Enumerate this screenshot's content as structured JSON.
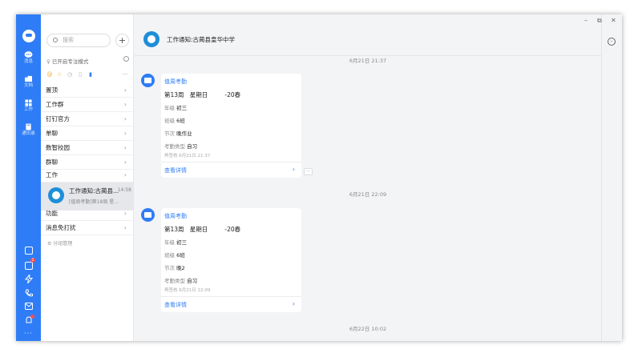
{
  "nav": {
    "items": [
      {
        "label": "消息",
        "icon": "message-icon"
      },
      {
        "label": "文档",
        "icon": "document-icon"
      },
      {
        "label": "工作",
        "icon": "work-grid-icon"
      },
      {
        "label": "通讯录",
        "icon": "contacts-icon"
      }
    ],
    "bottom_badge": "2"
  },
  "list": {
    "search_placeholder": "搜索",
    "focus_mode": "已开启专注模式",
    "groups_top": [
      "置顶",
      "工作群",
      "钉钉官方",
      "单聊",
      "数智校园",
      "群聊",
      "工作"
    ],
    "conversation": {
      "name": "工作通知:古蔺县...",
      "time": "14:58",
      "preview": "[值周考勤]第18周 星..."
    },
    "groups_bottom": [
      "功能",
      "消息免打扰"
    ],
    "manage": "分组管理"
  },
  "chat": {
    "title": "工作通知:古蔺县皇华中学",
    "messages": [
      {
        "time": "6月21日 21:37",
        "app": "值周考勤",
        "week": "第13周",
        "weekday": "星期日",
        "term": "-20春",
        "grade_label": "年级",
        "grade": "初三",
        "class_label": "班级",
        "class": "6班",
        "period_label": "节次",
        "period": "晚作业",
        "type_label": "考勤类型",
        "type": "自习",
        "publish": "再签核 6月21日 21:37",
        "view": "查看详情"
      },
      {
        "time": "6月21日 22:09",
        "app": "值周考勤",
        "week": "第13周",
        "weekday": "星期日",
        "term": "-20春",
        "grade_label": "年级",
        "grade": "初三",
        "class_label": "班级",
        "class": "6班",
        "period_label": "节次",
        "period": "晚2",
        "type_label": "考勤类型",
        "type": "自习",
        "publish": "再签核 6月21日 22:09",
        "view": "查看详情"
      }
    ],
    "bottom_time": "6月22日 10:02"
  },
  "colors": {
    "accent": "#2f7df6",
    "nav_bg": "#2f7df6",
    "chat_bg": "#f3f4f6"
  }
}
